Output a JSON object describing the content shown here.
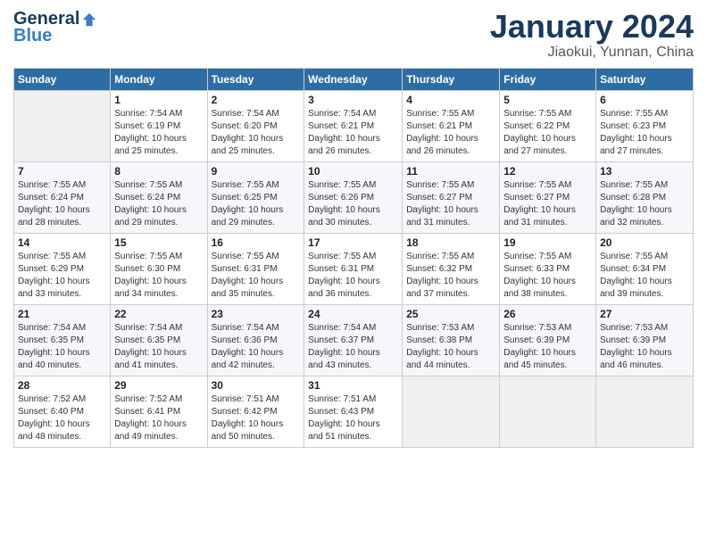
{
  "header": {
    "logo_general": "General",
    "logo_blue": "Blue",
    "month_title": "January 2024",
    "location": "Jiaokui, Yunnan, China"
  },
  "weekdays": [
    "Sunday",
    "Monday",
    "Tuesday",
    "Wednesday",
    "Thursday",
    "Friday",
    "Saturday"
  ],
  "weeks": [
    [
      {
        "day": "",
        "sunrise": "",
        "sunset": "",
        "daylight": ""
      },
      {
        "day": "1",
        "sunrise": "Sunrise: 7:54 AM",
        "sunset": "Sunset: 6:19 PM",
        "daylight": "Daylight: 10 hours and 25 minutes."
      },
      {
        "day": "2",
        "sunrise": "Sunrise: 7:54 AM",
        "sunset": "Sunset: 6:20 PM",
        "daylight": "Daylight: 10 hours and 25 minutes."
      },
      {
        "day": "3",
        "sunrise": "Sunrise: 7:54 AM",
        "sunset": "Sunset: 6:21 PM",
        "daylight": "Daylight: 10 hours and 26 minutes."
      },
      {
        "day": "4",
        "sunrise": "Sunrise: 7:55 AM",
        "sunset": "Sunset: 6:21 PM",
        "daylight": "Daylight: 10 hours and 26 minutes."
      },
      {
        "day": "5",
        "sunrise": "Sunrise: 7:55 AM",
        "sunset": "Sunset: 6:22 PM",
        "daylight": "Daylight: 10 hours and 27 minutes."
      },
      {
        "day": "6",
        "sunrise": "Sunrise: 7:55 AM",
        "sunset": "Sunset: 6:23 PM",
        "daylight": "Daylight: 10 hours and 27 minutes."
      }
    ],
    [
      {
        "day": "7",
        "sunrise": "Sunrise: 7:55 AM",
        "sunset": "Sunset: 6:24 PM",
        "daylight": "Daylight: 10 hours and 28 minutes."
      },
      {
        "day": "8",
        "sunrise": "Sunrise: 7:55 AM",
        "sunset": "Sunset: 6:24 PM",
        "daylight": "Daylight: 10 hours and 29 minutes."
      },
      {
        "day": "9",
        "sunrise": "Sunrise: 7:55 AM",
        "sunset": "Sunset: 6:25 PM",
        "daylight": "Daylight: 10 hours and 29 minutes."
      },
      {
        "day": "10",
        "sunrise": "Sunrise: 7:55 AM",
        "sunset": "Sunset: 6:26 PM",
        "daylight": "Daylight: 10 hours and 30 minutes."
      },
      {
        "day": "11",
        "sunrise": "Sunrise: 7:55 AM",
        "sunset": "Sunset: 6:27 PM",
        "daylight": "Daylight: 10 hours and 31 minutes."
      },
      {
        "day": "12",
        "sunrise": "Sunrise: 7:55 AM",
        "sunset": "Sunset: 6:27 PM",
        "daylight": "Daylight: 10 hours and 31 minutes."
      },
      {
        "day": "13",
        "sunrise": "Sunrise: 7:55 AM",
        "sunset": "Sunset: 6:28 PM",
        "daylight": "Daylight: 10 hours and 32 minutes."
      }
    ],
    [
      {
        "day": "14",
        "sunrise": "Sunrise: 7:55 AM",
        "sunset": "Sunset: 6:29 PM",
        "daylight": "Daylight: 10 hours and 33 minutes."
      },
      {
        "day": "15",
        "sunrise": "Sunrise: 7:55 AM",
        "sunset": "Sunset: 6:30 PM",
        "daylight": "Daylight: 10 hours and 34 minutes."
      },
      {
        "day": "16",
        "sunrise": "Sunrise: 7:55 AM",
        "sunset": "Sunset: 6:31 PM",
        "daylight": "Daylight: 10 hours and 35 minutes."
      },
      {
        "day": "17",
        "sunrise": "Sunrise: 7:55 AM",
        "sunset": "Sunset: 6:31 PM",
        "daylight": "Daylight: 10 hours and 36 minutes."
      },
      {
        "day": "18",
        "sunrise": "Sunrise: 7:55 AM",
        "sunset": "Sunset: 6:32 PM",
        "daylight": "Daylight: 10 hours and 37 minutes."
      },
      {
        "day": "19",
        "sunrise": "Sunrise: 7:55 AM",
        "sunset": "Sunset: 6:33 PM",
        "daylight": "Daylight: 10 hours and 38 minutes."
      },
      {
        "day": "20",
        "sunrise": "Sunrise: 7:55 AM",
        "sunset": "Sunset: 6:34 PM",
        "daylight": "Daylight: 10 hours and 39 minutes."
      }
    ],
    [
      {
        "day": "21",
        "sunrise": "Sunrise: 7:54 AM",
        "sunset": "Sunset: 6:35 PM",
        "daylight": "Daylight: 10 hours and 40 minutes."
      },
      {
        "day": "22",
        "sunrise": "Sunrise: 7:54 AM",
        "sunset": "Sunset: 6:35 PM",
        "daylight": "Daylight: 10 hours and 41 minutes."
      },
      {
        "day": "23",
        "sunrise": "Sunrise: 7:54 AM",
        "sunset": "Sunset: 6:36 PM",
        "daylight": "Daylight: 10 hours and 42 minutes."
      },
      {
        "day": "24",
        "sunrise": "Sunrise: 7:54 AM",
        "sunset": "Sunset: 6:37 PM",
        "daylight": "Daylight: 10 hours and 43 minutes."
      },
      {
        "day": "25",
        "sunrise": "Sunrise: 7:53 AM",
        "sunset": "Sunset: 6:38 PM",
        "daylight": "Daylight: 10 hours and 44 minutes."
      },
      {
        "day": "26",
        "sunrise": "Sunrise: 7:53 AM",
        "sunset": "Sunset: 6:39 PM",
        "daylight": "Daylight: 10 hours and 45 minutes."
      },
      {
        "day": "27",
        "sunrise": "Sunrise: 7:53 AM",
        "sunset": "Sunset: 6:39 PM",
        "daylight": "Daylight: 10 hours and 46 minutes."
      }
    ],
    [
      {
        "day": "28",
        "sunrise": "Sunrise: 7:52 AM",
        "sunset": "Sunset: 6:40 PM",
        "daylight": "Daylight: 10 hours and 48 minutes."
      },
      {
        "day": "29",
        "sunrise": "Sunrise: 7:52 AM",
        "sunset": "Sunset: 6:41 PM",
        "daylight": "Daylight: 10 hours and 49 minutes."
      },
      {
        "day": "30",
        "sunrise": "Sunrise: 7:51 AM",
        "sunset": "Sunset: 6:42 PM",
        "daylight": "Daylight: 10 hours and 50 minutes."
      },
      {
        "day": "31",
        "sunrise": "Sunrise: 7:51 AM",
        "sunset": "Sunset: 6:43 PM",
        "daylight": "Daylight: 10 hours and 51 minutes."
      },
      {
        "day": "",
        "sunrise": "",
        "sunset": "",
        "daylight": ""
      },
      {
        "day": "",
        "sunrise": "",
        "sunset": "",
        "daylight": ""
      },
      {
        "day": "",
        "sunrise": "",
        "sunset": "",
        "daylight": ""
      }
    ]
  ]
}
